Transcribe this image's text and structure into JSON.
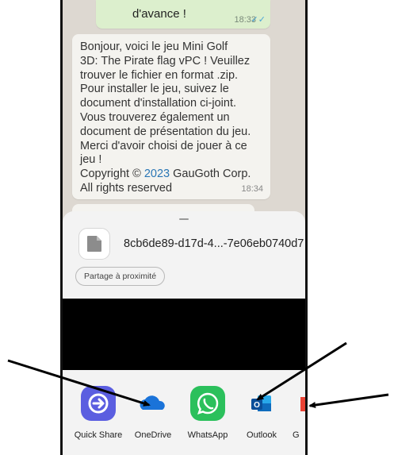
{
  "chat": {
    "sent_message": {
      "text": "d'avance !",
      "time": "18:33",
      "ticks": "✓✓"
    },
    "received_message": {
      "text_before_year": "Bonjour, voici le jeu Mini Golf\n3D: The Pirate flag vPC ! Veuillez\ntrouver le fichier en format .zip.\nPour installer le jeu, suivez le\ndocument d'installation ci-joint.\nVous trouverez également un\ndocument de présentation du jeu.\nMerci d'avoir choisi de jouer à ce\njeu !\nCopyright © ",
      "year": "2023",
      "text_after_year": " GauGoth Corp.\nAll rights reserved",
      "time": "18:34"
    }
  },
  "share_sheet": {
    "file_name": "8cb6de89-d17d-4...-7e06eb0740d7",
    "nearby_button": "Partage à proximité",
    "apps": [
      {
        "label": "Quick Share",
        "icon": "quick-share-icon",
        "color": "#5b5ee0"
      },
      {
        "label": "OneDrive",
        "icon": "onedrive-icon",
        "color": "#1a73d9"
      },
      {
        "label": "WhatsApp",
        "icon": "whatsapp-icon",
        "color": "#2bc05c"
      },
      {
        "label": "Outlook",
        "icon": "outlook-icon",
        "color": "#0f6cbd"
      },
      {
        "label": "G",
        "icon": "gmail-icon",
        "color": "#ea4335"
      }
    ]
  },
  "annotations": {
    "arrow_color": "#000000"
  }
}
